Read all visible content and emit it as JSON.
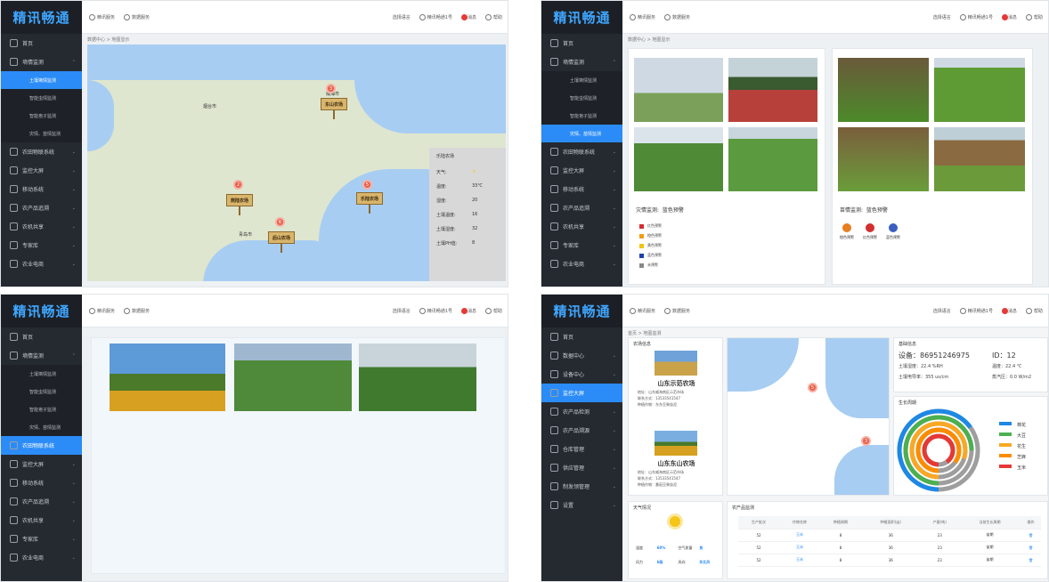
{
  "brand": "精讯畅通",
  "header": {
    "tab1": "精讯服务",
    "tab2": "数据服务",
    "lang": "选择语言",
    "user": "精讯畅通1号",
    "msg": "消息",
    "help": "帮助"
  },
  "sidebar1": {
    "items": [
      "首页",
      "墒情监测",
      "土壤墒情监测",
      "智能虫情监测",
      "智能孢子监测",
      "灾情、苗情监测",
      "农田物联系统",
      "监控大屏",
      "移动系统",
      "农产品追溯",
      "农机共享",
      "专家库",
      "农业电商"
    ]
  },
  "sidebar4": {
    "items": [
      "首页",
      "数据中心",
      "设备中心",
      "监控大屏",
      "农产品检测",
      "农产品溯源",
      "仓库管理",
      "供应管理",
      "制发领管理",
      "设置"
    ]
  },
  "p1": {
    "breadcrumb": "数据中心 > 地图显示",
    "pins": [
      {
        "num": "3",
        "label": "东山农场"
      },
      {
        "num": "2",
        "label": "熊陆农场"
      },
      {
        "num": "5",
        "label": "乐陆农场"
      },
      {
        "num": "6",
        "label": "后山农场"
      }
    ],
    "cities": [
      "威海市",
      "烟台市",
      "青岛市"
    ],
    "info": {
      "title": "乐陆农场",
      "rows": [
        {
          "k": "天气:",
          "v": "☀"
        },
        {
          "k": "温度:",
          "v": "33℃"
        },
        {
          "k": "湿度:",
          "v": "20"
        },
        {
          "k": "土壤温度:",
          "v": "16"
        },
        {
          "k": "土壤湿度:",
          "v": "32"
        },
        {
          "k": "土壤PH值:",
          "v": "8"
        }
      ]
    }
  },
  "p2": {
    "breadcrumb": "数据中心 > 地图显示",
    "disaster_title": "灾情监测:",
    "disaster_level": "蓝色预警",
    "disaster_legend": [
      "红色预警",
      "橙色预警",
      "黄色预警",
      "蓝色预警",
      "未预警"
    ],
    "disaster_colors": [
      "#d32f2f",
      "#f39c12",
      "#f1c40f",
      "#1e40af",
      "#888888"
    ],
    "seed_title": "苗情监测:",
    "seed_level": "蓝色预警",
    "seed_legend": [
      "橙色预警",
      "红色预警",
      "蓝色预警"
    ],
    "seed_colors": [
      "#e67e22",
      "#d32f2f",
      "#3b5fbf"
    ]
  },
  "p4": {
    "breadcrumb": "首页 > 地图监测",
    "farm_section": "农场信息",
    "farms": [
      {
        "name": "山东示范农场",
        "addr": "地址：山东威海南区示范市场",
        "phone": "联系方式：13533541547",
        "crop": "种植作物：东东豆果苗泥"
      },
      {
        "name": "山东东山农场",
        "addr": "地址：山东威海南区示范市场",
        "phone": "联系方式：13533541547",
        "crop": "种植作物：番茄豆果苗泥"
      }
    ],
    "device_section": "基础信息",
    "device_label": "设备：86951246975",
    "device_id": "ID：12",
    "readings": [
      "土壤湿度：22.4 %RH",
      "温度：22.4 ℃",
      "土壤电导率：355 us/cm",
      "蒸汽压：0.0 W/m2"
    ],
    "map_clusters": [
      "5",
      "3"
    ],
    "chart_title": "生长周期",
    "weather_title": "天气情况",
    "weather": [
      {
        "k": "湿度",
        "v": "60%"
      },
      {
        "k": "空气质量",
        "v": "良"
      },
      {
        "k": "风力",
        "v": "6级"
      },
      {
        "k": "风向",
        "v": "东北风"
      }
    ],
    "table_title": "农产品监测",
    "table_headers": [
      "生产批次",
      "作物名称",
      "种植周期",
      "种植面积(亩)",
      "产量(吨)",
      "当前生长周期",
      "操作"
    ],
    "table_rows": [
      [
        "52",
        "玉米",
        "8",
        "36",
        "23",
        "苗期"
      ],
      [
        "52",
        "玉米",
        "8",
        "36",
        "23",
        "苗期"
      ],
      [
        "52",
        "玉米",
        "8",
        "36",
        "23",
        "苗期"
      ]
    ]
  },
  "chart_data": {
    "type": "pie",
    "title": "生长周期",
    "categories": [
      "棉花",
      "大豆",
      "花生",
      "芝麻",
      "玉米"
    ],
    "colors": [
      "#1e88e5",
      "#4caf50",
      "#f9a825",
      "#fb8c00",
      "#e53935"
    ],
    "values": [
      65,
      75,
      80,
      85,
      90
    ]
  }
}
